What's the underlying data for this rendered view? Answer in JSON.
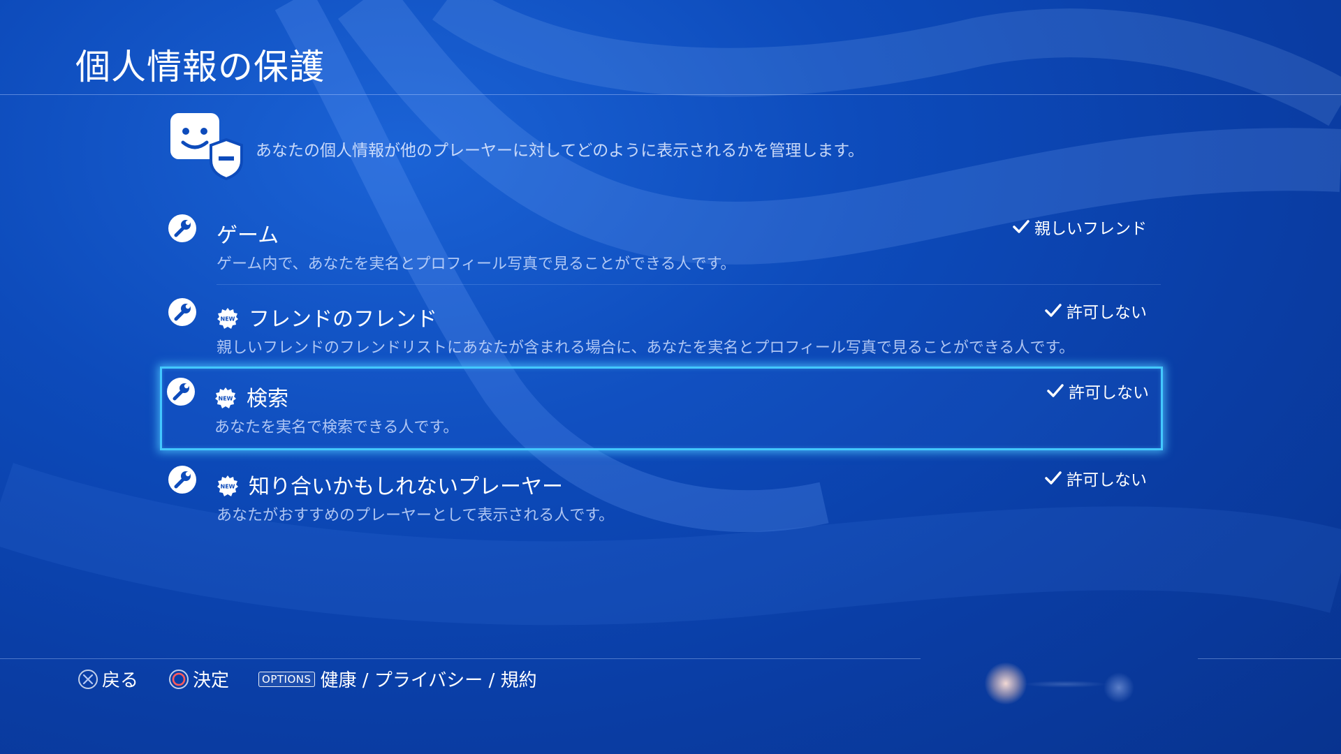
{
  "header": {
    "title": "個人情報の保護"
  },
  "intro": {
    "icon": "privacy-face-shield-icon",
    "text": "あなたの個人情報が他のプレーヤーに対してどのように表示されるかを管理します。"
  },
  "settings": [
    {
      "icon": "wrench-icon",
      "is_new": false,
      "title": "ゲーム",
      "description": "ゲーム内で、あなたを実名とプロフィール写真で見ることができる人です。",
      "value": "親しいフレンド",
      "selected": false
    },
    {
      "icon": "wrench-icon",
      "is_new": true,
      "title": "フレンドのフレンド",
      "description": "親しいフレンドのフレンドリストにあなたが含まれる場合に、あなたを実名とプロフィール写真で見ることができる人です。",
      "value": "許可しない",
      "selected": false
    },
    {
      "icon": "wrench-icon",
      "is_new": true,
      "title": "検索",
      "description": "あなたを実名で検索できる人です。",
      "value": "許可しない",
      "selected": true
    },
    {
      "icon": "wrench-icon",
      "is_new": true,
      "title": "知り合いかもしれないプレーヤー",
      "description": "あなたがおすすめのプレーヤーとして表示される人です。",
      "value": "許可しない",
      "selected": false
    }
  ],
  "new_badge_label": "NEW",
  "footer": {
    "back_label": "戻る",
    "confirm_label": "決定",
    "options_badge": "OPTIONS",
    "options_label": "健康 / プライバシー / 規約"
  },
  "colors": {
    "background": "#0d4bbb",
    "selection_glow": "#43c8ff",
    "text": "#ffffff"
  }
}
